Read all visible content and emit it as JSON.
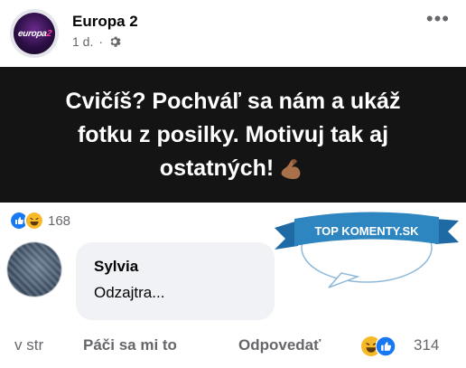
{
  "post": {
    "page_name": "Europa 2",
    "time": "1 d.",
    "separator": "·",
    "more": "•••",
    "logo_text_main": "europa",
    "logo_text_accent": "2",
    "banner_line1": "Cvičíš? Pochváľ sa nám a ukáž",
    "banner_line2": "fotku z posilky. Motivuj tak aj",
    "banner_line3": "ostatných!",
    "reaction_count": "168"
  },
  "comment": {
    "author": "Sylvia",
    "text": "Odzajtra...",
    "actions": {
      "time": "v str",
      "like": "Páči sa mi to",
      "reply": "Odpovedať",
      "reaction_count": "314"
    }
  },
  "watermark": {
    "text": "TOP KOMENTY.SK"
  },
  "colors": {
    "banner_bg": "#141414",
    "like_blue": "#1877f2",
    "haha_yellow": "#f7b928",
    "watermark_blue": "#2e86c1"
  },
  "icons": [
    "gear-icon",
    "more-icon",
    "like-reaction-icon",
    "haha-reaction-icon",
    "flexed-biceps-icon"
  ]
}
